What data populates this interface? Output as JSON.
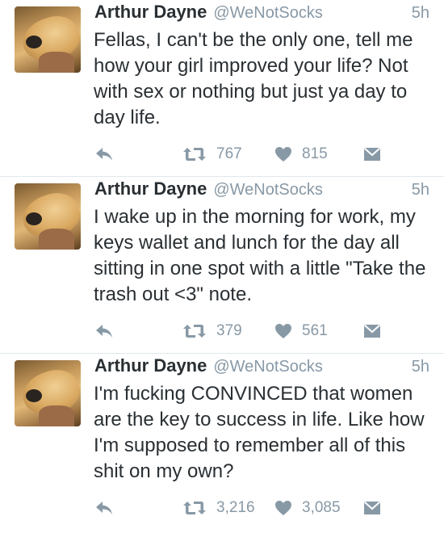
{
  "tweets": [
    {
      "name": "Arthur Dayne",
      "handle": "@WeNotSocks",
      "time": "5h",
      "text": "Fellas, I can't be the only one, tell me how your girl improved your life? Not with sex or nothing but just ya day to day life.",
      "retweets": "767",
      "likes": "815"
    },
    {
      "name": "Arthur Dayne",
      "handle": "@WeNotSocks",
      "time": "5h",
      "text": "I wake up in the morning for work, my keys wallet and lunch for the day all sitting in one spot with a little \"Take the trash out <3\" note.",
      "retweets": "379",
      "likes": "561"
    },
    {
      "name": "Arthur Dayne",
      "handle": "@WeNotSocks",
      "time": "5h",
      "text": "I'm fucking CONVINCED that women are the key to success in life. Like how I'm supposed to remember all of this shit on my own?",
      "retweets": "3,216",
      "likes": "3,085"
    }
  ],
  "icons": {
    "reply": "reply-icon",
    "retweet": "retweet-icon",
    "like": "heart-icon",
    "message": "envelope-icon"
  },
  "colors": {
    "text": "#292f33",
    "muted": "#8899a6",
    "divider": "#e1e8ed"
  }
}
